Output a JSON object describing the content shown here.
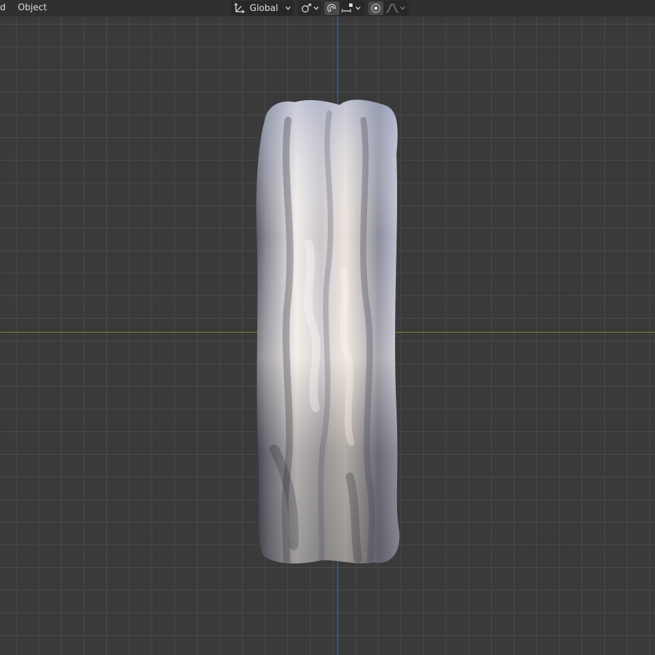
{
  "header": {
    "menu": [
      "d",
      "Object"
    ],
    "transform_orientation": {
      "value": "Global",
      "icon": "transform-orientation-icon",
      "caret": "chevron-down-icon"
    },
    "pivot": {
      "icon": "link-icon"
    },
    "snap": {
      "icon": "magnet-icon",
      "target_icon": "snap-target-icon"
    },
    "proportional_editing": {
      "icon": "proportional-editing-icon",
      "falloff_icon": "falloff-curve-icon"
    }
  },
  "viewport": {
    "background_color": "#3a3a3a",
    "grid_color": "#4a4a4a",
    "x_axis_color": "#6e8a2e",
    "y_axis_color": "#3f6ea8",
    "object": "metallic-crumpled-column"
  }
}
